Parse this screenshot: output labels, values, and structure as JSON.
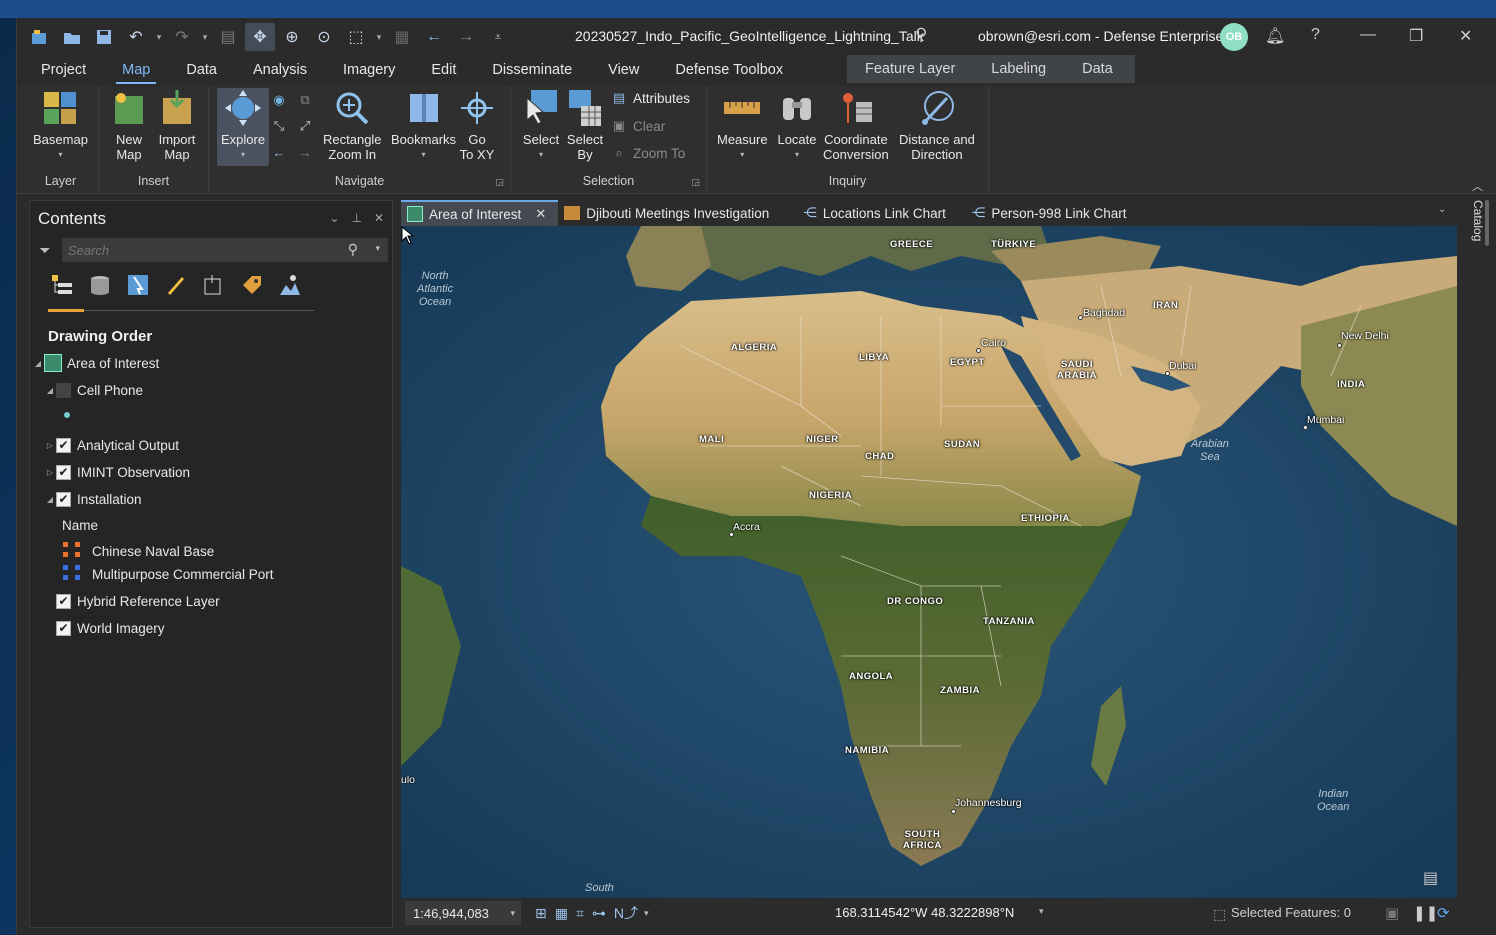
{
  "title_bar": {
    "project_title": "20230527_Indo_Pacific_GeoIntelligence_Lightning_Talk",
    "account": "obrown@esri.com - Defense Enterprise",
    "avatar_initials": "OB"
  },
  "ribbon_tabs": [
    "Project",
    "Map",
    "Data",
    "Analysis",
    "Imagery",
    "Edit",
    "Disseminate",
    "View",
    "Defense Toolbox"
  ],
  "active_ribbon_tab": "Map",
  "contextual_tabs": [
    "Feature Layer",
    "Labeling",
    "Data"
  ],
  "ribbon": {
    "layer": {
      "label": "Layer",
      "basemap": "Basemap"
    },
    "insert": {
      "label": "Insert",
      "new_map_1": "New",
      "new_map_2": "Map",
      "import_map_1": "Import",
      "import_map_2": "Map"
    },
    "navigate": {
      "label": "Navigate",
      "explore": "Explore",
      "rect_zoom_1": "Rectangle",
      "rect_zoom_2": "Zoom In",
      "bookmarks": "Bookmarks",
      "goto_1": "Go",
      "goto_2": "To XY"
    },
    "selection": {
      "label": "Selection",
      "select": "Select",
      "select_by_1": "Select",
      "select_by_2": "By",
      "attributes": "Attributes",
      "clear": "Clear",
      "zoom_to": "Zoom To"
    },
    "inquiry": {
      "label": "Inquiry",
      "measure": "Measure",
      "locate": "Locate",
      "coord_1": "Coordinate",
      "coord_2": "Conversion",
      "dist_1": "Distance and",
      "dist_2": "Direction"
    }
  },
  "contents": {
    "title": "Contents",
    "search_placeholder": "Search",
    "section": "Drawing Order",
    "layers": {
      "area_of_interest": "Area of Interest",
      "cell_phone": "Cell Phone",
      "analytical_output": "Analytical Output",
      "imint": "IMINT Observation",
      "installation": "Installation",
      "name_header": "Name",
      "legend_1": "Chinese Naval Base",
      "legend_2": "Multipurpose Commercial Port",
      "hybrid": "Hybrid Reference Layer",
      "world_imagery": "World Imagery"
    }
  },
  "map_tabs": [
    "Area of Interest",
    "Djibouti Meetings Investigation",
    "Locations Link Chart",
    "Person-998 Link Chart"
  ],
  "map": {
    "countries": {
      "greece": "GREECE",
      "turkiye": "TÜRKIYE",
      "algeria": "ALGERIA",
      "libya": "LIBYA",
      "egypt": "EGYPT",
      "saudi_1": "SAUDI",
      "saudi_2": "ARABIA",
      "iran": "IRAN",
      "india": "INDIA",
      "mali": "MALI",
      "niger": "NIGER",
      "chad": "CHAD",
      "sudan": "SUDAN",
      "nigeria": "NIGERIA",
      "ethiopia": "ETHIOPIA",
      "drc": "DR CONGO",
      "tanzania": "TANZANIA",
      "angola": "ANGOLA",
      "zambia": "ZAMBIA",
      "namibia": "NAMIBIA",
      "sa_1": "SOUTH",
      "sa_2": "AFRICA"
    },
    "cities": {
      "baghdad": "Baghdad",
      "cairo": "Cairo",
      "dubai": "Dubai",
      "new_delhi": "New Delhi",
      "mumbai": "Mumbai",
      "accra": "Accra",
      "johannesburg": "Johannesburg",
      "lulo": "ulo"
    },
    "oceans": {
      "north_atlantic": "North\nAtlantic\nOcean",
      "arabian_sea": "Arabian\nSea",
      "indian_ocean": "Indian\nOcean",
      "south": "South"
    }
  },
  "status_bar": {
    "scale": "1:46,944,083",
    "coordinates": "168.3114542°W 48.3222898°N",
    "selected_features": "Selected Features: 0"
  },
  "side": {
    "catalog": "Catalog"
  }
}
